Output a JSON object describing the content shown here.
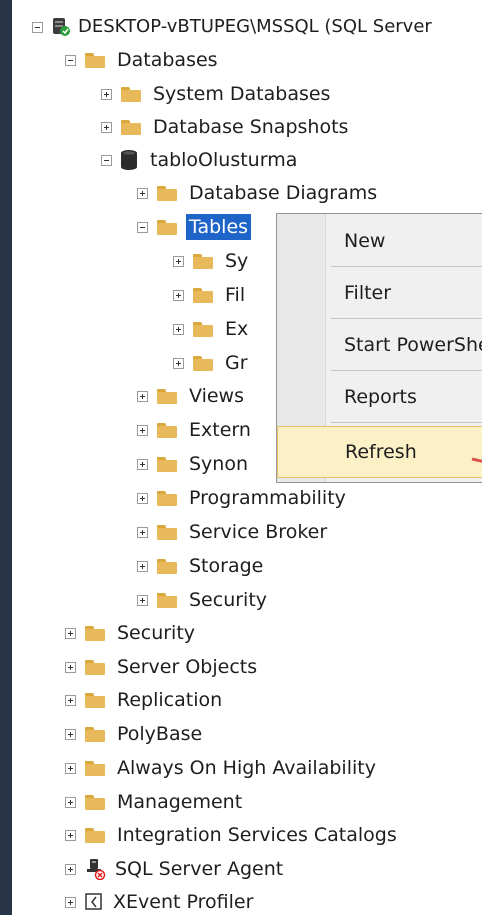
{
  "tree": {
    "server": "DESKTOP-vBTUPEG\\MSSQL (SQL Server",
    "databases": "Databases",
    "system_databases": "System Databases",
    "database_snapshots": "Database Snapshots",
    "db_name": "tabloOlusturma",
    "database_diagrams": "Database Diagrams",
    "tables": "Tables",
    "tables_children": [
      "Sy",
      "Fil",
      "Ex",
      "Gr"
    ],
    "views": "Views",
    "external": "Extern",
    "synonyms": "Synon",
    "programmability": "Programmability",
    "service_broker": "Service Broker",
    "storage": "Storage",
    "db_security": "Security",
    "security": "Security",
    "server_objects": "Server Objects",
    "replication": "Replication",
    "polybase": "PolyBase",
    "always_on": "Always On High Availability",
    "management": "Management",
    "integration_services": "Integration Services Catalogs",
    "sql_server_agent": "SQL Server Agent",
    "xevent_profiler": "XEvent Profiler"
  },
  "context_menu": {
    "items": [
      "New",
      "Filter",
      "Start PowerShell",
      "Reports",
      "Refresh"
    ],
    "highlighted": "Refresh"
  },
  "colors": {
    "background": "#283548",
    "selection": "#1f64c8",
    "menu_highlight": "#fbf0c6",
    "folder": "#e7b95a",
    "arrow": "#d9534f"
  },
  "icons": {
    "server": "server-icon",
    "database": "database-icon",
    "folder": "folder-icon",
    "agent": "sql-agent-icon",
    "xevent": "xevent-icon"
  }
}
